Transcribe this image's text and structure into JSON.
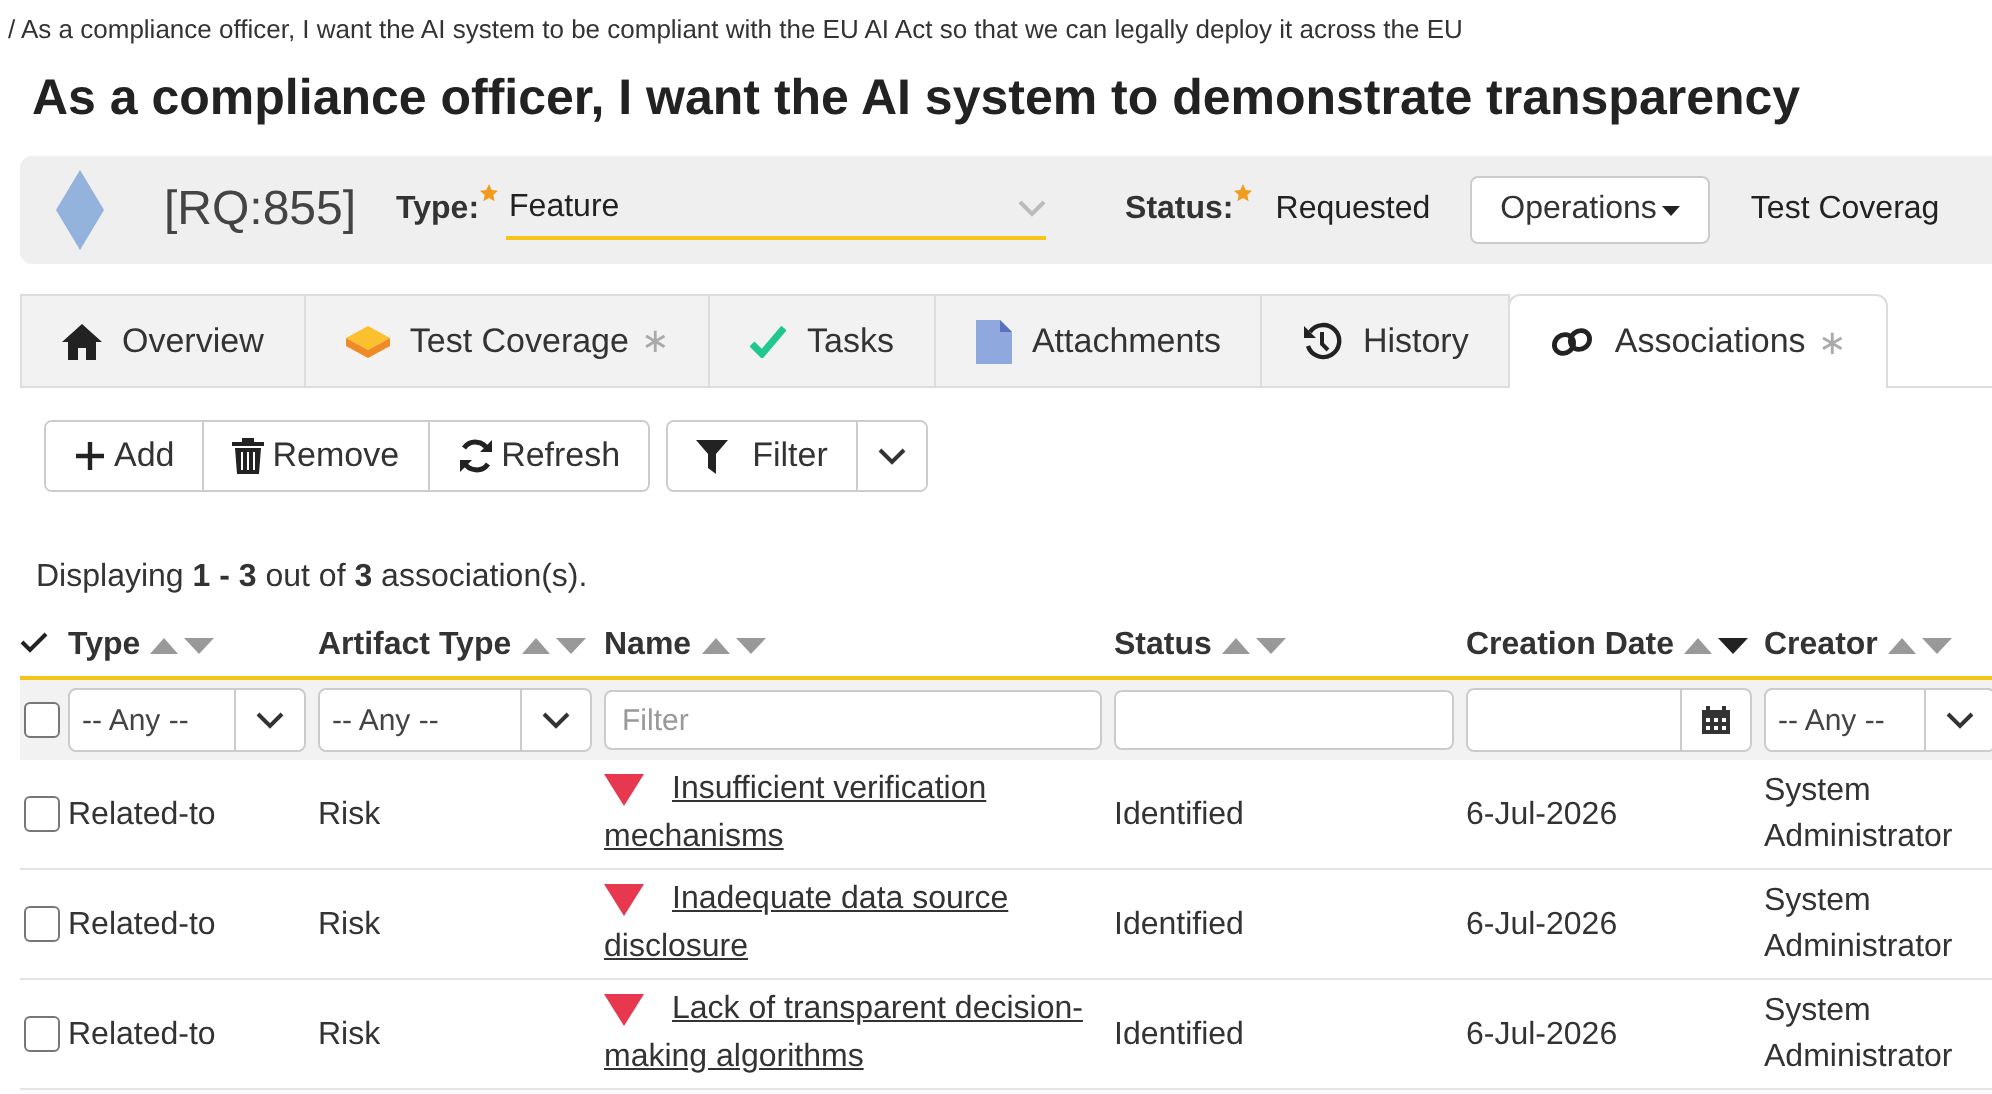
{
  "breadcrumb": "/ As a compliance officer, I want the AI system to be compliant with the EU AI Act so that we can legally deploy it across the EU",
  "title": "As a compliance officer, I want the AI system to demonstrate transparency",
  "header": {
    "id": "[RQ:855]",
    "type_label": "Type:",
    "type_required": true,
    "type_value": "Feature",
    "status_label": "Status:",
    "status_required": true,
    "status_value": "Requested",
    "operations": "Operations",
    "extra": "Test Coverag"
  },
  "tabs": [
    {
      "label": "Overview",
      "selected": false
    },
    {
      "label": "Test Coverage",
      "badge": "∗",
      "selected": false
    },
    {
      "label": "Tasks",
      "selected": false
    },
    {
      "label": "Attachments",
      "selected": false
    },
    {
      "label": "History",
      "selected": false
    },
    {
      "label": "Associations",
      "badge": "∗",
      "selected": true
    }
  ],
  "toolbar": [
    {
      "label": "Add"
    },
    {
      "label": "Remove"
    },
    {
      "label": "Refresh"
    }
  ],
  "filter_button": "Filter",
  "summary": "Displaying **1 - 3** out of **3** association(s).",
  "table": {
    "select_all_checked": false,
    "columns": [
      {
        "label": "Type",
        "sorted_descending": false,
        "filter": {
          "kind": "select",
          "value": "-- Any --"
        }
      },
      {
        "label": "Artifact Type",
        "sorted_descending": false,
        "filter": {
          "kind": "select",
          "value": "-- Any --"
        }
      },
      {
        "label": "Name",
        "sorted_descending": false,
        "filter": {
          "kind": "text",
          "placeholder": "Filter"
        }
      },
      {
        "label": "Status",
        "sorted_descending": false,
        "filter": {
          "kind": "text"
        }
      },
      {
        "label": "Creation Date",
        "sorted_descending": true,
        "filter": {
          "kind": "date"
        }
      },
      {
        "label": "Creator",
        "sorted_descending": false,
        "filter": {
          "kind": "select",
          "value": "-- Any --"
        }
      }
    ],
    "rows": [
      {
        "checked": false,
        "type": "Related-to",
        "artifact_type": "Risk",
        "name": "Insufficient verification mechanisms",
        "status": "Identified",
        "created": "6-Jul-2026",
        "creator": "System Administrator"
      },
      {
        "checked": false,
        "type": "Related-to",
        "artifact_type": "Risk",
        "name": "Inadequate data source disclosure",
        "status": "Identified",
        "created": "6-Jul-2026",
        "creator": "System Administrator"
      },
      {
        "checked": false,
        "type": "Related-to",
        "artifact_type": "Risk",
        "name": "Lack of transparent decision-making algorithms",
        "status": "Identified",
        "created": "6-Jul-2026",
        "creator": "System Administrator"
      }
    ]
  }
}
